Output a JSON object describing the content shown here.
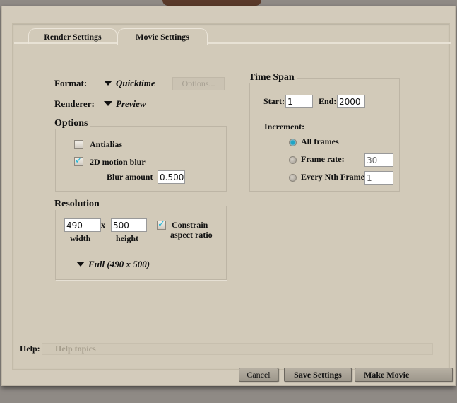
{
  "tabs": [
    "Render Settings",
    "Movie Settings"
  ],
  "format": {
    "label": "Format:",
    "value": "Quicktime",
    "options_button": "Options..."
  },
  "renderer": {
    "label": "Renderer:",
    "value": "Preview"
  },
  "options": {
    "title": "Options",
    "antialias": {
      "label": "Antialias",
      "checked": false
    },
    "motion_blur": {
      "label": "2D motion blur",
      "checked": true
    },
    "blur_amount_label": "Blur amount",
    "blur_amount": "0.500"
  },
  "resolution": {
    "title": "Resolution",
    "width": "490",
    "height": "500",
    "x_sep": "x",
    "width_label": "width",
    "height_label": "height",
    "constrain_line1": "Constrain",
    "constrain_line2": "aspect ratio",
    "constrain_checked": true,
    "preset": "Full (490 x 500)"
  },
  "time_span": {
    "title": "Time Span",
    "start_label": "Start:",
    "start": "1",
    "end_label": "End:",
    "end": "2000",
    "increment_label": "Increment:",
    "all_frames": "All frames",
    "frame_rate_label": "Frame rate:",
    "frame_rate": "30",
    "every_nth_label": "Every Nth Frame",
    "every_nth": "1",
    "selected": "All frames"
  },
  "help": {
    "label": "Help:",
    "placeholder": "Help topics"
  },
  "buttons": {
    "cancel": "Cancel",
    "save": "Save Settings",
    "make": "Make Movie"
  }
}
